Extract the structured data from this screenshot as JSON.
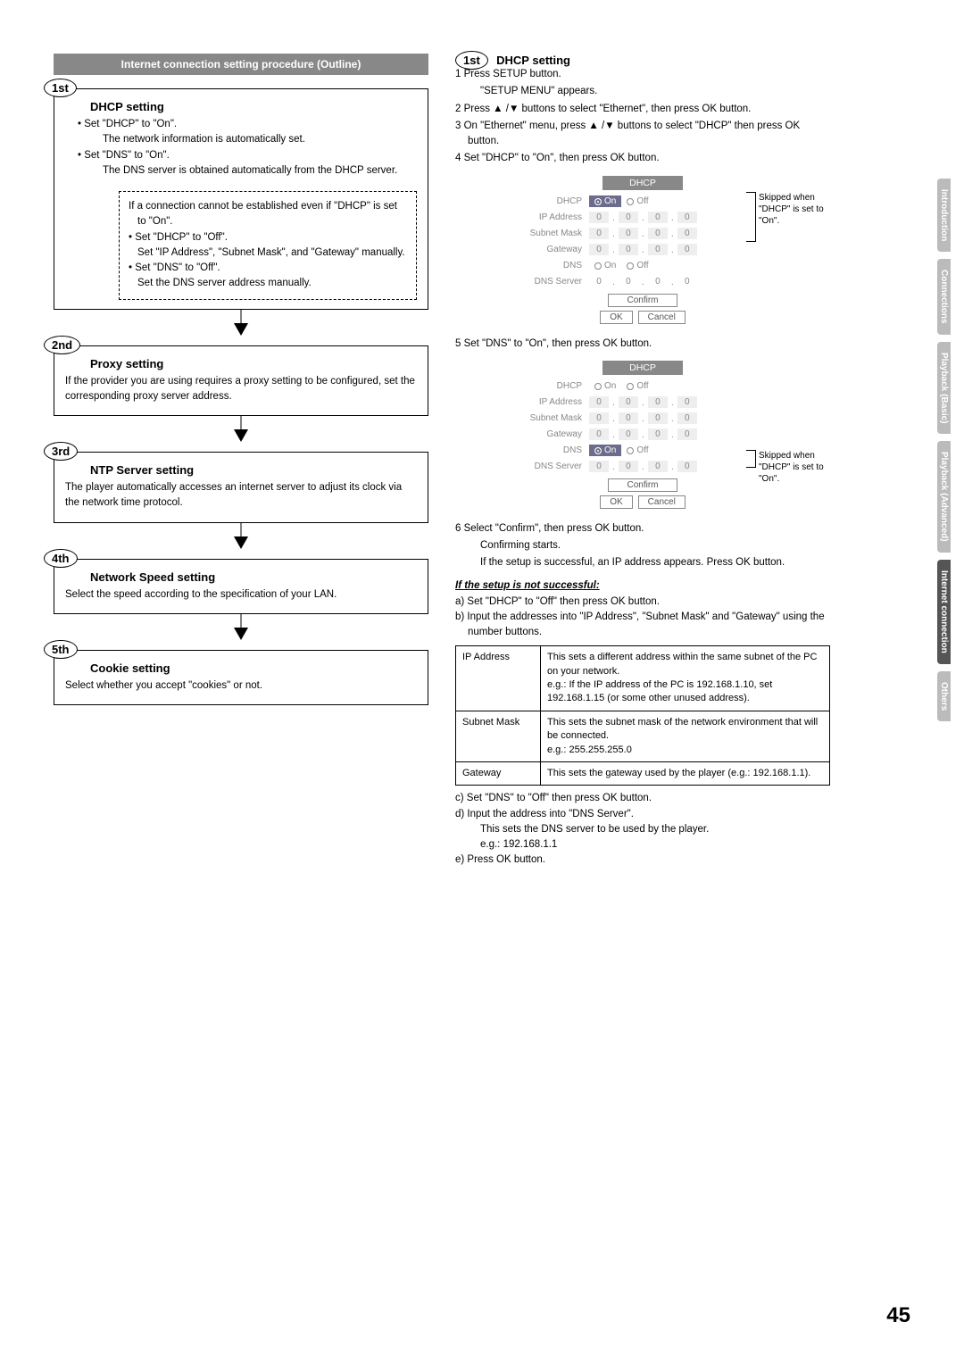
{
  "pageNumber": "45",
  "outlineTitle": "Internet connection setting procedure (Outline)",
  "steps": {
    "s1": {
      "badge": "1st",
      "title": "DHCP setting",
      "b1": "• Set \"DHCP\" to \"On\".",
      "b1a": "The network information is automatically set.",
      "b2": "• Set \"DNS\" to \"On\".",
      "b2a": "The DNS server is obtained automatically from the DHCP server."
    },
    "dashed": {
      "l1": "If a connection cannot be established even if \"DHCP\" is set to \"On\".",
      "l2": "• Set \"DHCP\" to \"Off\".",
      "l2a": "Set \"IP Address\", \"Subnet Mask\", and \"Gateway\" manually.",
      "l3": "• Set \"DNS\" to \"Off\".",
      "l3a": "Set the DNS server address manually."
    },
    "s2": {
      "badge": "2nd",
      "title": "Proxy setting",
      "body": "If the provider you are using requires a proxy setting to be configured, set the corresponding proxy server address."
    },
    "s3": {
      "badge": "3rd",
      "title": "NTP Server setting",
      "body": "The player automatically accesses an internet server to adjust its clock via the network time protocol."
    },
    "s4": {
      "badge": "4th",
      "title": "Network Speed setting",
      "body": "Select the speed according to the specification of your LAN."
    },
    "s5": {
      "badge": "5th",
      "title": "Cookie setting",
      "body": "Select whether you accept \"cookies\" or not."
    }
  },
  "right": {
    "badge": "1st",
    "title": "DHCP setting",
    "n1": "1  Press SETUP button.",
    "n1a": "\"SETUP MENU\" appears.",
    "n2": "2  Press ▲ /▼ buttons to select \"Ethernet\", then press OK button.",
    "n3": "3  On \"Ethernet\" menu, press ▲ /▼ buttons to select \"DHCP\" then press OK button.",
    "n4": "4  Set \"DHCP\" to \"On\", then press OK button.",
    "n5": "5  Set \"DNS\" to \"On\", then press OK button.",
    "n6": "6  Select \"Confirm\", then press OK button.",
    "n6a": "Confirming starts.",
    "n6b": "If the setup is successful, an IP address appears. Press OK button.",
    "unsuccessful": "If the setup is not successful:",
    "a": "a)  Set \"DHCP\" to \"Off\" then press OK button.",
    "b": "b)  Input the addresses into \"IP Address\", \"Subnet Mask\" and \"Gateway\" using the number buttons.",
    "c": "c)  Set \"DNS\" to \"Off\" then press OK button.",
    "d": "d)  Input the address into \"DNS Server\".",
    "d1": "This sets the DNS server to be used by the player.",
    "d2": "e.g.: 192.168.1.1",
    "e": "e)  Press OK button.",
    "table": {
      "r1l": "IP Address",
      "r1r": "This sets a different address within the same subnet of the PC on your network.\ne.g.: If the IP address of the PC is 192.168.1.10, set 192.168.1.15 (or some other unused address).",
      "r2l": "Subnet Mask",
      "r2r": "This sets the subnet mask of the network environment that will be connected.\ne.g.: 255.255.255.0",
      "r3l": "Gateway",
      "r3r": "This sets the gateway used by the player (e.g.: 192.168.1.1)."
    }
  },
  "panel": {
    "title": "DHCP",
    "labels": {
      "dhcp": "DHCP",
      "ip": "IP Address",
      "subnet": "Subnet Mask",
      "gateway": "Gateway",
      "dns": "DNS",
      "dnsserver": "DNS Server"
    },
    "on": "On",
    "off": "Off",
    "confirm": "Confirm",
    "ok": "OK",
    "cancel": "Cancel",
    "zero": "0"
  },
  "skipNote": "Skipped when \"DHCP\" is set to \"On\".",
  "tabs": [
    "Introduction",
    "Connections",
    "Playback (Basic)",
    "Playback (Advanced)",
    "Internet connection",
    "Others"
  ]
}
